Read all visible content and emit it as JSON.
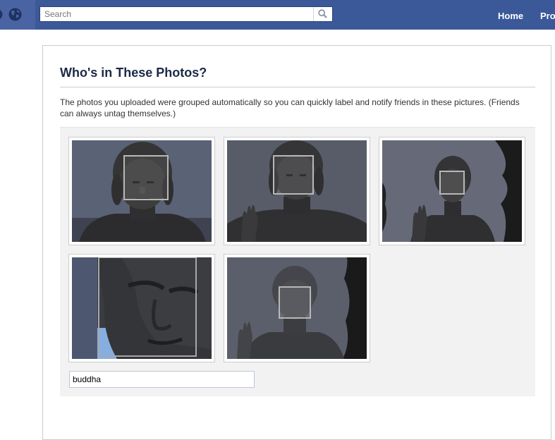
{
  "header": {
    "search_placeholder": "Search",
    "nav": [
      "Home",
      "Profile"
    ]
  },
  "page": {
    "title": "Who's in These Photos?",
    "description": "The photos you uploaded were grouped automatically so you can quickly label and notify friends in these pictures. (Friends can always untag themselves.)"
  },
  "name_input": {
    "value": "buddha"
  },
  "colors": {
    "header_bg": "#3b5998",
    "title_text": "#1c2a47",
    "grid_bg": "#f2f2f2"
  }
}
